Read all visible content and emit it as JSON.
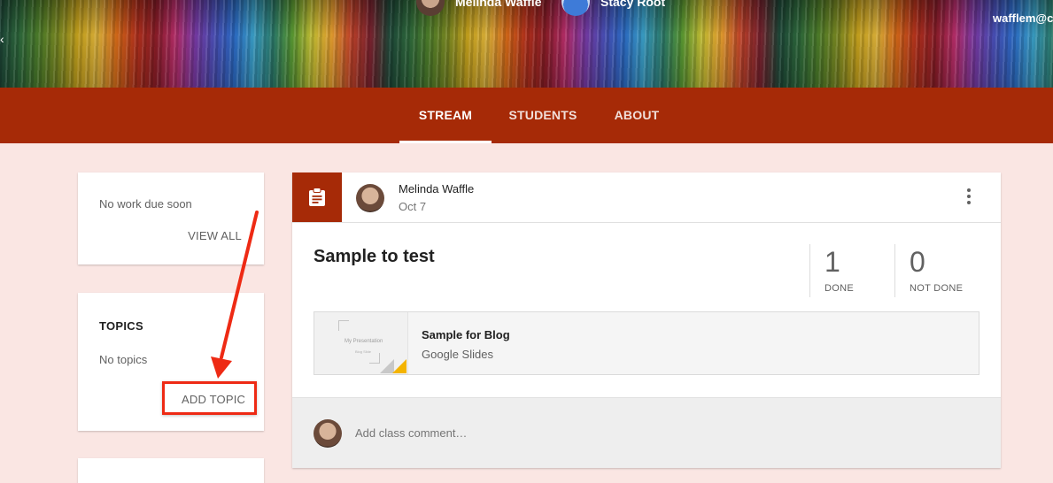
{
  "banner": {
    "teacher_name": "Melinda Waffle",
    "class_owner": "Stacy Root",
    "account_email": "wafflem@c"
  },
  "tabs": [
    {
      "label": "STREAM",
      "active": true
    },
    {
      "label": "STUDENTS",
      "active": false
    },
    {
      "label": "ABOUT",
      "active": false
    }
  ],
  "upcoming": {
    "message": "No work due soon",
    "view_all_label": "VIEW ALL"
  },
  "topics": {
    "heading": "TOPICS",
    "empty_message": "No topics",
    "add_label": "ADD TOPIC"
  },
  "post": {
    "author": "Melinda Waffle",
    "date": "Oct 7",
    "title": "Sample to test",
    "done_count": "1",
    "done_label": "DONE",
    "not_done_count": "0",
    "not_done_label": "NOT DONE",
    "attachment": {
      "title": "Sample for Blog",
      "type": "Google Slides",
      "thumbnail_title": "My Presentation",
      "thumbnail_subtitle": "Blog Slide"
    },
    "comment_placeholder": "Add class comment…"
  },
  "colors": {
    "accent": "#a62a07",
    "background": "#fae6e3",
    "annotation": "#ee2a14"
  }
}
